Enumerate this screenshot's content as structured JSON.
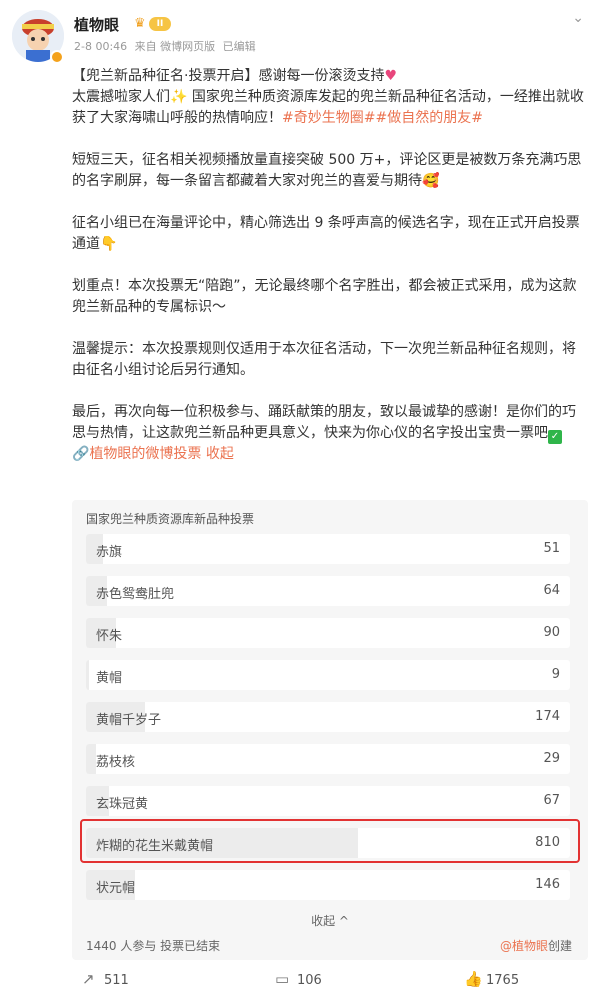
{
  "author": {
    "name": "植物眼",
    "vip_label": "II",
    "time": "2-8 00:46",
    "source": "来自 微博网页版",
    "edited": "已编辑"
  },
  "post": {
    "line1_pre": "【兜兰新品种征名·投票开启】感谢每一份滚烫支持",
    "line2_pre": "太震撼啦家人们",
    "line2_post": " 国家兜兰种质资源库发起的兜兰新品种征名活动，一经推出就收获了大家海啸山呼般的热情响应！",
    "tag1": "#奇妙生物圈#",
    "tag2": "#做自然的朋友#",
    "para2": "短短三天，征名相关视频播放量直接突破 500 万+，评论区更是被数万条充满巧思的名字刷屏，每一条留言都藏着大家对兜兰的喜爱与期待",
    "para3": "征名小组已在海量评论中，精心筛选出 9 条呼声高的候选名字，现在正式开启投票通道",
    "para4": "划重点！本次投票无“陪跑”，无论最终哪个名字胜出，都会被正式采用，成为这款兜兰新品种的专属标识～",
    "para5": "温馨提示：本次投票规则仅适用于本次征名活动，下一次兜兰新品种征名规则，将由征名小组讨论后另行通知。",
    "para6": "最后，再次向每一位积极参与、踊跃献策的朋友，致以最诚挚的感谢！是你们的巧思与热情，让这款兜兰新品种更具意义，快来为你心仪的名字投出宝贵一票吧",
    "vote_link": "植物眼的微博投票",
    "collapse_link": "收起"
  },
  "poll": {
    "title": "国家兜兰种质资源库新品种投票",
    "options": [
      {
        "label": "赤旗",
        "count": "51",
        "share": 0.035
      },
      {
        "label": "赤色鸳鸯肚兜",
        "count": "64",
        "share": 0.044
      },
      {
        "label": "怀朱",
        "count": "90",
        "share": 0.063
      },
      {
        "label": "黄帽",
        "count": "9",
        "share": 0.006
      },
      {
        "label": "黄帽千岁子",
        "count": "174",
        "share": 0.121
      },
      {
        "label": "荔枝核",
        "count": "29",
        "share": 0.02
      },
      {
        "label": "玄珠冠黄",
        "count": "67",
        "share": 0.047
      },
      {
        "label": "炸糊的花生米戴黄帽",
        "count": "810",
        "share": 0.563
      },
      {
        "label": "状元帽",
        "count": "146",
        "share": 0.101
      }
    ],
    "collapse": "收起 ^",
    "participants": "1440 人参与 投票已结束",
    "creator_name": "@植物眼",
    "creator_suffix": "创建"
  },
  "actions": {
    "share": "511",
    "comment": "106",
    "like": "1765"
  }
}
